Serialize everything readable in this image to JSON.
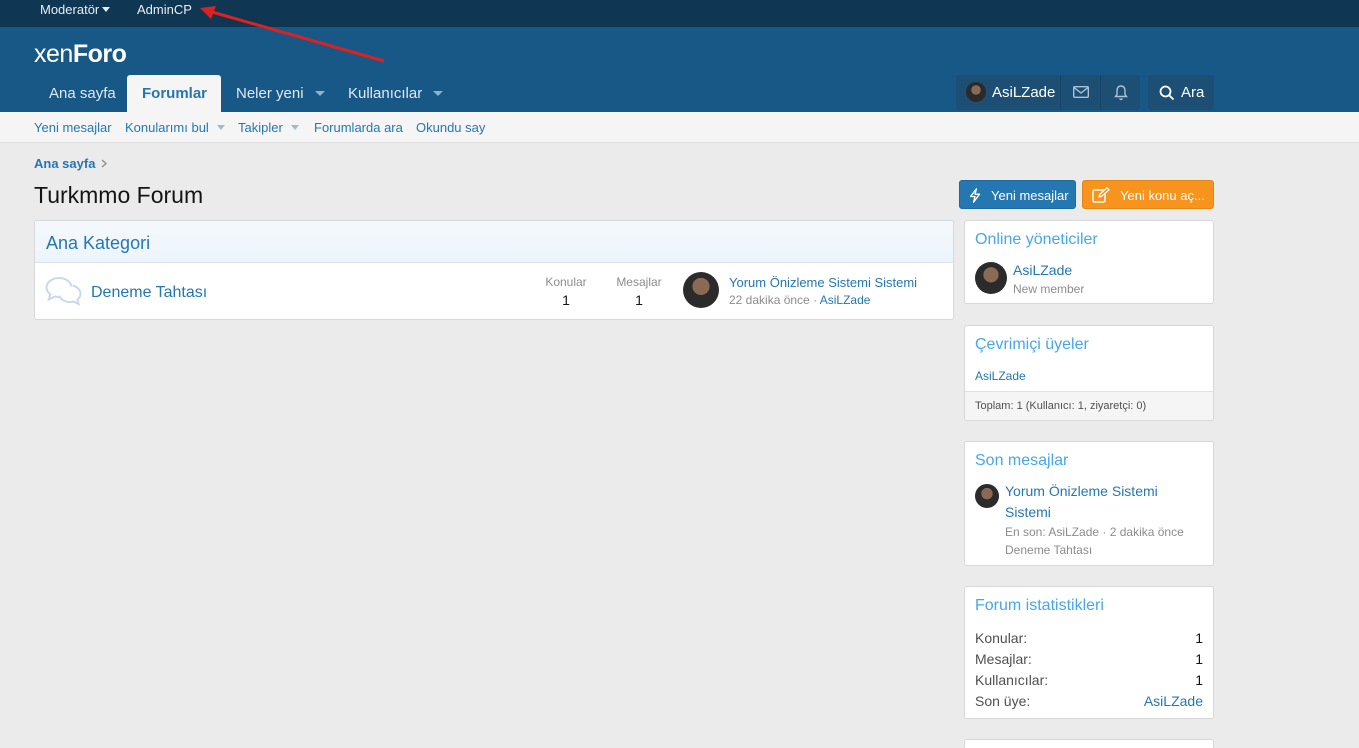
{
  "staff_bar": {
    "moderator": "Moderatör",
    "admincp": "AdminCP"
  },
  "logo": {
    "light": "xen",
    "bold": "Foro"
  },
  "nav": {
    "tabs": [
      {
        "label": "Ana sayfa"
      },
      {
        "label": "Forumlar"
      },
      {
        "label": "Neler yeni"
      },
      {
        "label": "Kullanıcılar"
      }
    ],
    "account_name": "AsiLZade",
    "search_label": "Ara"
  },
  "subnav": {
    "items": [
      "Yeni mesajlar",
      "Konularımı bul",
      "Takipler",
      "Forumlarda ara",
      "Okundu say"
    ]
  },
  "breadcrumb": "Ana sayfa",
  "page_title": "Turkmmo Forum",
  "buttons": {
    "new_posts": "Yeni mesajlar",
    "new_thread": "Yeni konu aç..."
  },
  "category": {
    "title": "Ana Kategori",
    "forum": {
      "title": "Deneme Tahtası",
      "threads_label": "Konular",
      "threads": "1",
      "messages_label": "Mesajlar",
      "messages": "1",
      "last_title": "Yorum Önizleme Sistemi Sistemi",
      "last_time": "22 dakika önce",
      "last_sep": " · ",
      "last_user": "AsiLZade"
    }
  },
  "sidebar": {
    "online_staff": {
      "title": "Online yöneticiler",
      "name": "AsiLZade",
      "role": "New member"
    },
    "online_members": {
      "title": "Çevrimiçi üyeler",
      "name": "AsiLZade",
      "footer": "Toplam: 1 (Kullanıcı: 1, ziyaretçi: 0)"
    },
    "recent_posts": {
      "title": "Son mesajlar",
      "thread_line1": "Yorum Önizleme Sistemi",
      "thread_line2": "Sistemi",
      "meta": "En son: AsiLZade · 2 dakika önce",
      "forum": "Deneme Tahtası"
    },
    "forum_stats": {
      "title": "Forum istatistikleri",
      "rows": [
        {
          "label": "Konular:",
          "value": "1"
        },
        {
          "label": "Mesajlar:",
          "value": "1"
        },
        {
          "label": "Kullanıcılar:",
          "value": "1"
        },
        {
          "label": "Son üye:",
          "value": "AsiLZade"
        }
      ]
    }
  },
  "colors": {
    "header": "#185886",
    "staff_bar": "#0f3652",
    "link": "#2577b1",
    "accent_orange": "#f7941d",
    "annotation_arrow": "#e02020"
  }
}
